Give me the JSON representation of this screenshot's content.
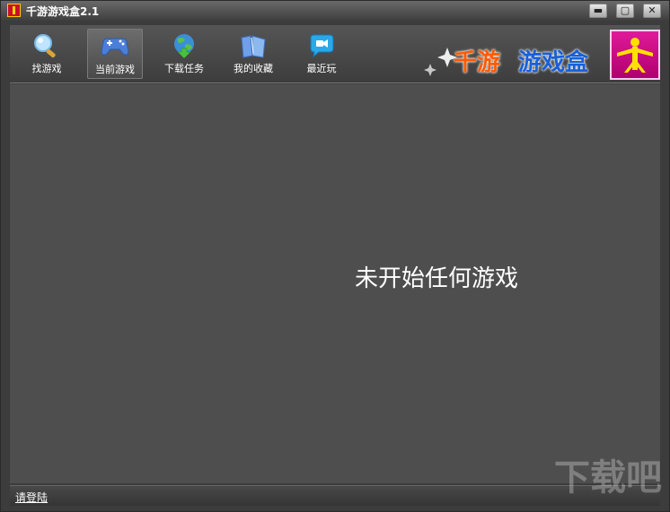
{
  "window": {
    "title": "千游游戏盒2.1",
    "minimize_label": "▬",
    "maximize_label": "▢",
    "close_label": "✕"
  },
  "toolbar": {
    "items": [
      {
        "label": "找游戏",
        "icon": "magnifier-icon"
      },
      {
        "label": "当前游戏",
        "icon": "gamepad-icon",
        "active": true
      },
      {
        "label": "下载任务",
        "icon": "globe-download-icon"
      },
      {
        "label": "我的收藏",
        "icon": "folder-icon"
      },
      {
        "label": "最近玩",
        "icon": "chat-bubble-icon"
      }
    ]
  },
  "logo": {
    "text1": "千游",
    "text2": "游戏盒"
  },
  "content": {
    "empty_message": "未开始任何游戏"
  },
  "statusbar": {
    "login_label": "请登陆"
  },
  "watermark": {
    "text": "下载吧"
  },
  "colors": {
    "accent_orange": "#ff5a00",
    "accent_blue": "#1a5fd8",
    "badge_pink": "#e01a9a"
  }
}
